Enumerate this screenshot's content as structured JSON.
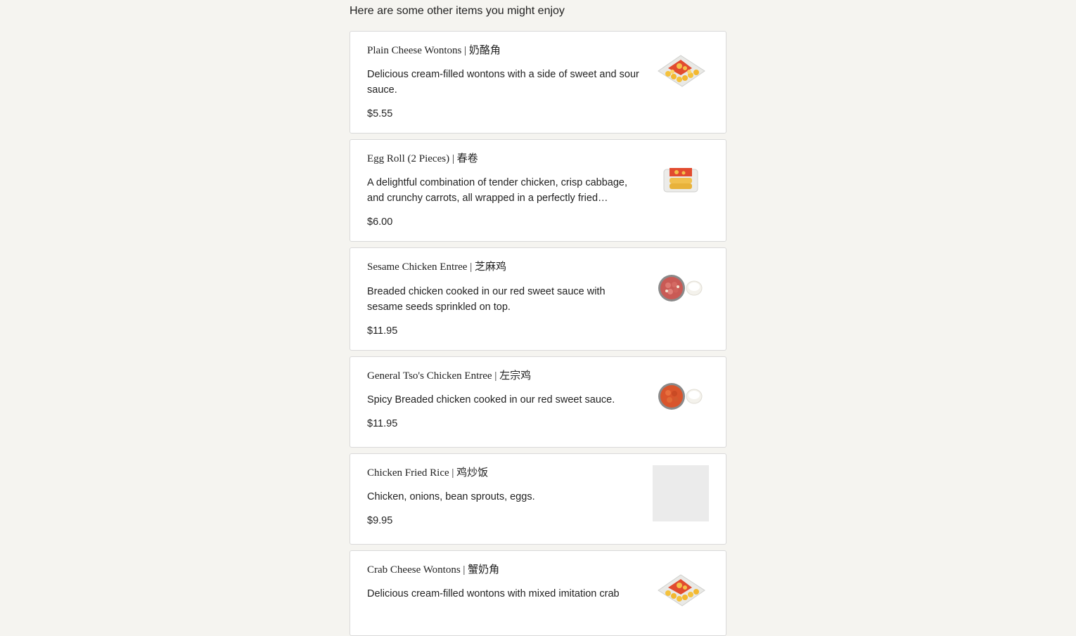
{
  "section_title": "Here are some other items you might enjoy",
  "items": [
    {
      "name": "Plain Cheese Wontons | 奶酪角",
      "description": "Delicious cream-filled wontons with a side of sweet and sour sauce.",
      "price": "$5.55",
      "image": "wontons-tray-image"
    },
    {
      "name": "Egg Roll (2 Pieces) | 春卷",
      "description": "A delightful combination of tender chicken, crisp cabbage, and crunchy carrots, all wrapped in a perfectly fried golden…",
      "price": "$6.00",
      "image": "egg-roll-tray-image"
    },
    {
      "name": "Sesame Chicken Entree | 芝麻鸡",
      "description": "Breaded chicken cooked in our red sweet sauce with sesame seeds sprinkled on top.",
      "price": "$11.95",
      "image": "sesame-chicken-bowl-image"
    },
    {
      "name": "General Tso's Chicken Entree | 左宗鸡",
      "description": "Spicy Breaded chicken cooked in our red sweet sauce.",
      "price": "$11.95",
      "image": "general-tso-bowl-image"
    },
    {
      "name": "Chicken Fried Rice | 鸡炒饭",
      "description": "Chicken, onions, bean sprouts, eggs.",
      "price": "$9.95",
      "image": "image-placeholder"
    },
    {
      "name": "Crab Cheese Wontons | 蟹奶角",
      "description": "Delicious cream-filled wontons with mixed imitation crab",
      "price": "",
      "image": "wontons-tray-image"
    }
  ]
}
